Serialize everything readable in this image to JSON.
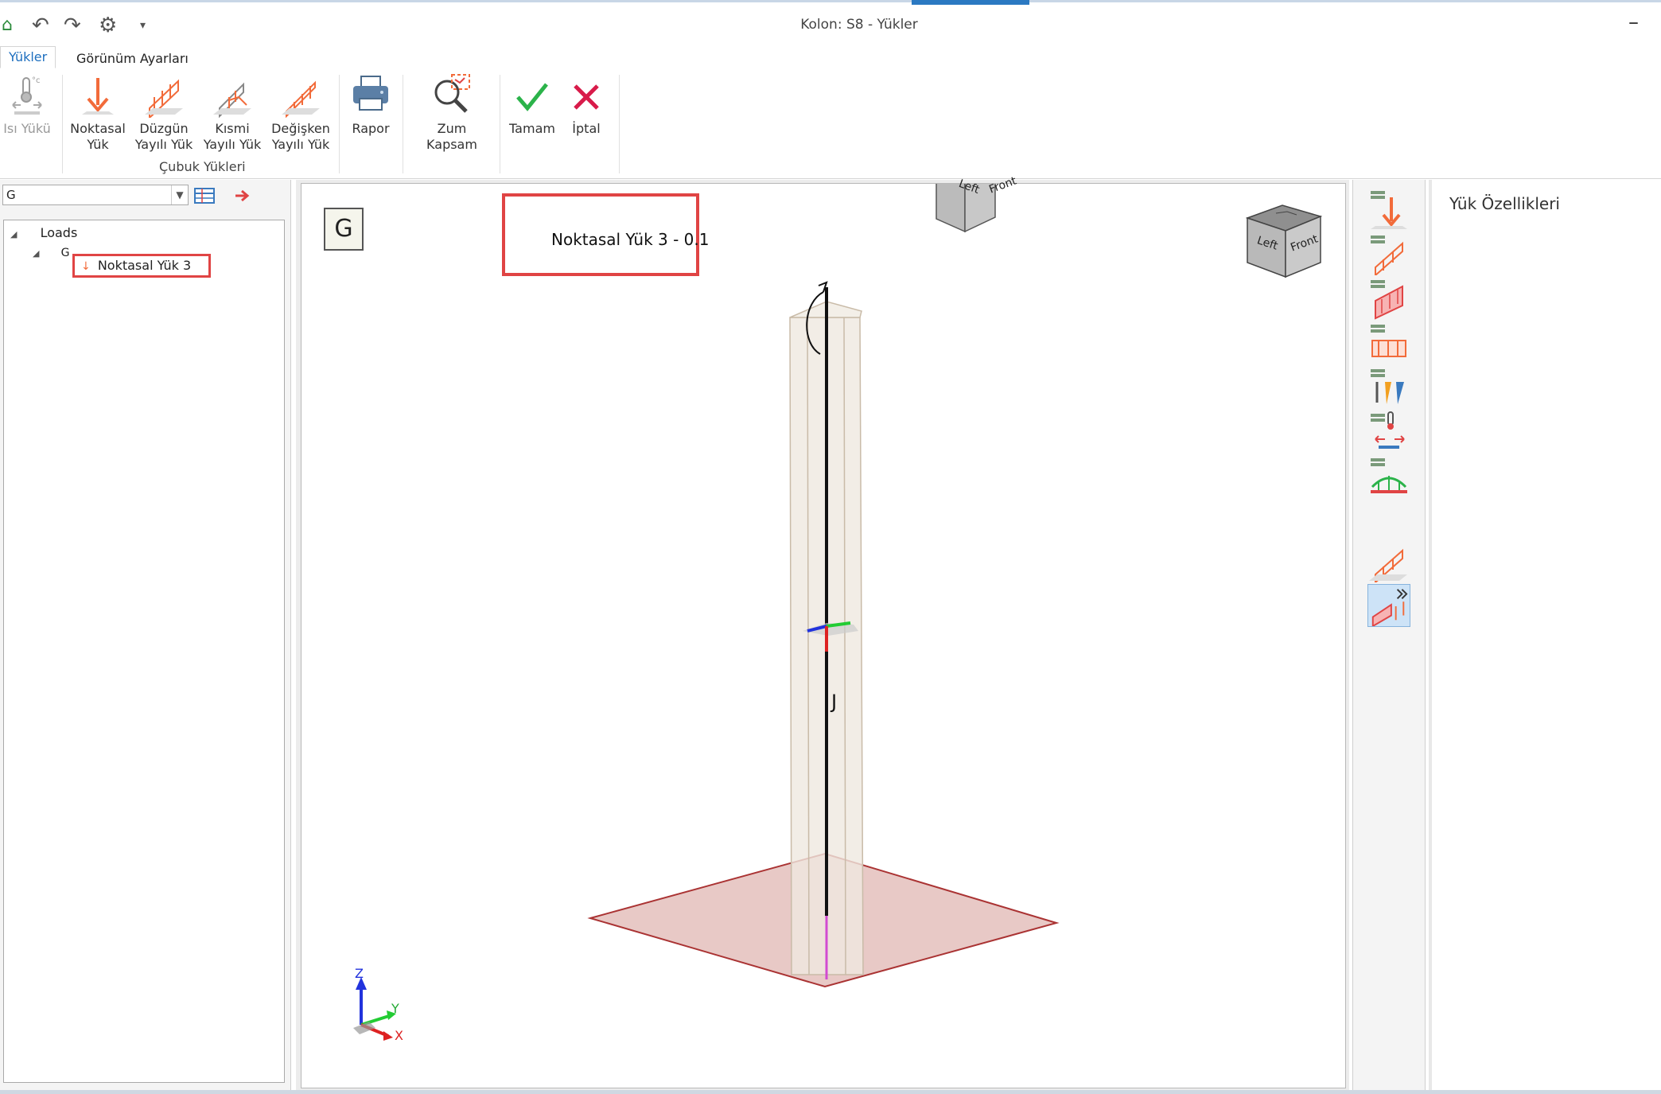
{
  "window": {
    "title": "Kolon: S8 - Yükler",
    "minimize_label": "–"
  },
  "tabs": [
    {
      "label": "Yükler",
      "active": true
    },
    {
      "label": "Görünüm Ayarları",
      "active": false
    }
  ],
  "ribbon": {
    "heat_load": "Isı Yükü",
    "point_load_1": "Noktasal",
    "point_load_2": "Yük",
    "uniform_load_1": "Düzgün",
    "uniform_load_2": "Yayılı Yük",
    "partial_load_1": "Kısmi",
    "partial_load_2": "Yayılı Yük",
    "variable_load_1": "Değişken",
    "variable_load_2": "Yayılı Yük",
    "group_label": "Çubuk Yükleri",
    "report": "Rapor",
    "zoom_extents": "Zum Kapsam",
    "ok": "Tamam",
    "cancel": "İptal"
  },
  "left_panel": {
    "combo_value": "G",
    "tree": {
      "root": "Loads",
      "group": "G",
      "item": "Noktasal Yük 3"
    }
  },
  "viewport": {
    "case_badge": "G",
    "load_label": "Noktasal Yük 3 - 0.1",
    "joint_label": "J",
    "cube_left": "Left",
    "cube_front": "Front",
    "axis_z": "Z",
    "axis_y": "Y",
    "axis_x": "X"
  },
  "properties": {
    "title": "Yük Özellikleri"
  },
  "colors": {
    "accent_blue": "#2b79c2",
    "highlight_red": "#e04444",
    "load_orange": "#f26b3a",
    "ok_green": "#2bb34a",
    "cancel_red": "#d81b4a"
  }
}
